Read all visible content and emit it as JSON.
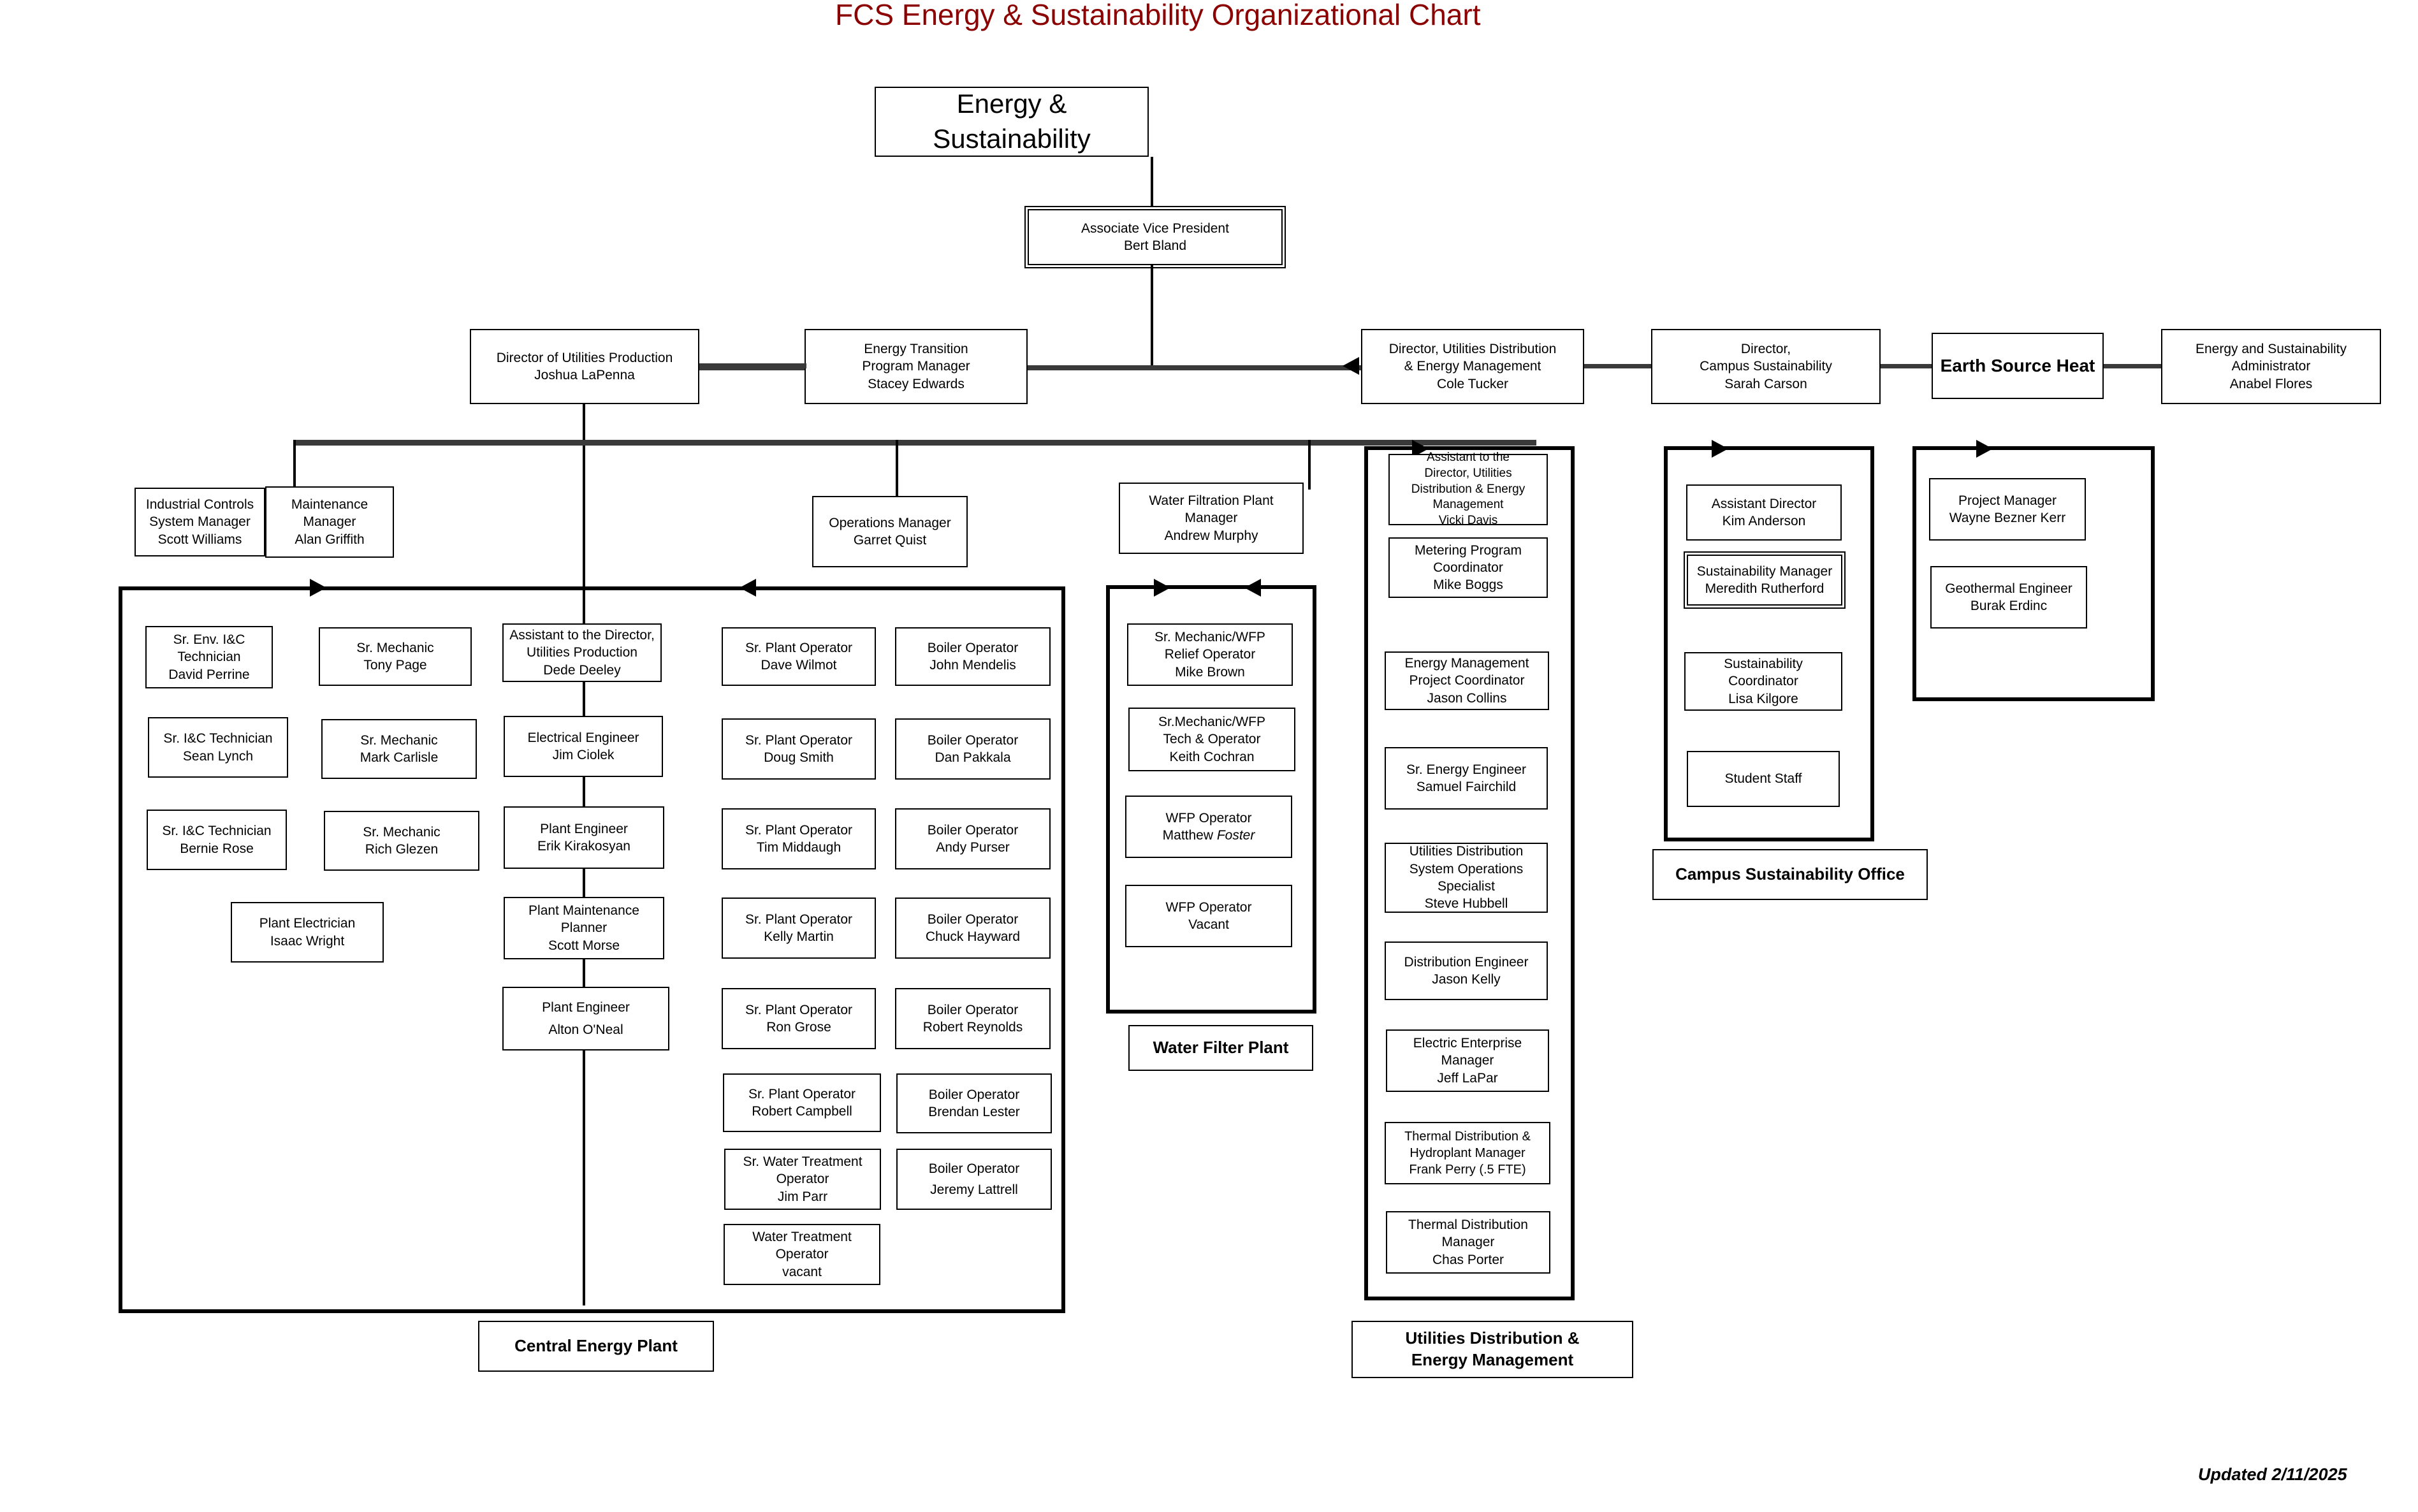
{
  "title": "FCS Energy & Sustainability Organizational Chart",
  "footer": "Updated 2/11/2025",
  "root": {
    "label": "Energy & Sustainability"
  },
  "avp": {
    "title": "Associate Vice President",
    "name": "Bert Bland"
  },
  "directors": {
    "utilities_production": {
      "title": "Director of Utilities Production",
      "name": "Joshua LaPenna"
    },
    "energy_transition": {
      "line1": "Energy  Transition",
      "line2": "Program Manager",
      "name": "Stacey Edwards"
    },
    "utilities_distribution": {
      "line1": "Director, Utilities Distribution",
      "line2": "& Energy Management",
      "name": "Cole Tucker"
    },
    "campus_sustainability": {
      "line1": "Director,",
      "line2": "Campus Sustainability",
      "name": "Sarah Carson"
    },
    "earth_source_heat": {
      "label": "Earth Source Heat"
    },
    "admin": {
      "line1": "Energy and Sustainability",
      "line2": "Administrator",
      "name": "Anabel Flores"
    }
  },
  "managers": {
    "industrial_controls": {
      "line1": "Industrial Controls",
      "line2": "System Manager",
      "name": "Scott Williams"
    },
    "maintenance": {
      "line1": "Maintenance",
      "line2": "Manager",
      "name": "Alan Griffith"
    },
    "operations": {
      "line1": "Operations Manager",
      "name": "Garret Quist"
    },
    "water_filtration": {
      "line1": "Water Filtration Plant",
      "line2": "Manager",
      "name": "Andrew Murphy"
    }
  },
  "group_labels": {
    "central_energy_plant": "Central Energy Plant",
    "water_filter_plant": "Water Filter Plant",
    "utilities_distribution_energy_management": {
      "line1": "Utilities Distribution &",
      "line2": "Energy Management"
    },
    "campus_sustainability_office": "Campus Sustainability Office"
  },
  "columns": {
    "ic_technicians": [
      {
        "line1": "Sr. Env. I&C",
        "line2": "Technician",
        "name": "David Perrine"
      },
      {
        "line1": "Sr. I&C Technician",
        "name": "Sean Lynch"
      },
      {
        "line1": "Sr. I&C Technician",
        "name": "Bernie Rose"
      }
    ],
    "plant_electrician": {
      "line1": "Plant Electrician",
      "name": "Isaac Wright"
    },
    "mechanics": [
      {
        "line1": "Sr. Mechanic",
        "name": "Tony Page"
      },
      {
        "line1": "Sr. Mechanic",
        "name": "Mark Carlisle"
      },
      {
        "line1": "Sr. Mechanic",
        "name": "Rich Glezen"
      }
    ],
    "engineering": [
      {
        "line1": "Assistant to the Director,",
        "line2": "Utilities Production",
        "name": "Dede Deeley"
      },
      {
        "line1": "Electrical Engineer",
        "name": "Jim Ciolek"
      },
      {
        "line1": "Plant Engineer",
        "name": "Erik Kirakosyan"
      },
      {
        "line1": "Plant Maintenance",
        "line2": "Planner",
        "name": "Scott Morse"
      },
      {
        "line1": "Plant Engineer",
        "name": "Alton O'Neal"
      }
    ],
    "plant_operators": [
      {
        "line1": "Sr. Plant Operator",
        "name": "Dave Wilmot"
      },
      {
        "line1": "Sr. Plant Operator",
        "name": "Doug Smith"
      },
      {
        "line1": "Sr. Plant Operator",
        "name": "Tim Middaugh"
      },
      {
        "line1": "Sr. Plant Operator",
        "name": "Kelly Martin"
      },
      {
        "line1": "Sr. Plant Operator",
        "name": "Ron Grose"
      },
      {
        "line1": "Sr. Plant Operator",
        "name": "Robert Campbell"
      },
      {
        "line1": "Sr. Water Treatment",
        "line2": "Operator",
        "name": "Jim Parr"
      },
      {
        "line1": "Water Treatment",
        "line2": "Operator",
        "name": "vacant"
      }
    ],
    "boiler_operators": [
      {
        "line1": "Boiler Operator",
        "name": "John Mendelis"
      },
      {
        "line1": "Boiler Operator",
        "name": "Dan Pakkala"
      },
      {
        "line1": "Boiler Operator",
        "name": "Andy Purser"
      },
      {
        "line1": "Boiler Operator",
        "name": "Chuck Hayward"
      },
      {
        "line1": "Boiler Operator",
        "name": "Robert Reynolds"
      },
      {
        "line1": "Boiler Operator",
        "name": "Brendan Lester"
      },
      {
        "line1": "Boiler Operator",
        "name": "Jeremy Lattrell"
      }
    ],
    "water_filter_plant": [
      {
        "line1": "Sr. Mechanic/WFP",
        "line2": "Relief Operator",
        "name": "Mike Brown"
      },
      {
        "line1": "Sr.Mechanic/WFP",
        "line2": "Tech & Operator",
        "name": "Keith Cochran"
      },
      {
        "line1": "WFP Operator",
        "name": "Matthew ",
        "name_italic": "Foster"
      },
      {
        "line1": "WFP Operator",
        "name": "Vacant"
      }
    ],
    "utilities_distribution": [
      {
        "line1": "Assistant to the",
        "line2": "Director, Utilities",
        "line3": "Distribution & Energy",
        "line4": "Management",
        "name": "Vicki Davis"
      },
      {
        "line1": "Metering Program",
        "line2": "Coordinator",
        "name": "Mike Boggs"
      },
      {
        "line1": "Energy Management",
        "line2": "Project Coordinator",
        "name": "Jason Collins"
      },
      {
        "line1": "Sr. Energy Engineer",
        "name": "Samuel Fairchild"
      },
      {
        "line1": "Utilities Distribution",
        "line2": "System Operations",
        "line3": "Specialist",
        "name": "Steve Hubbell"
      },
      {
        "line1": "Distribution Engineer",
        "name": "Jason Kelly"
      },
      {
        "line1": "Electric Enterprise",
        "line2": "Manager",
        "name": "Jeff LaPar"
      },
      {
        "line1": "Thermal Distribution &",
        "line2": "Hydroplant  Manager",
        "name": "Frank Perry (.5 FTE)"
      },
      {
        "line1": "Thermal Distribution",
        "line2": "Manager",
        "name": "Chas Porter"
      }
    ],
    "campus_sustainability": [
      {
        "line1": "Assistant Director",
        "name": "Kim Anderson"
      },
      {
        "line1": "Sustainability Manager",
        "name": "Meredith Rutherford"
      },
      {
        "line1": "Sustainability",
        "line2": "Coordinator",
        "name": "Lisa Kilgore"
      },
      {
        "line1": "Student Staff"
      }
    ],
    "earth_source_heat": [
      {
        "line1": "Project Manager",
        "name": "Wayne Bezner Kerr"
      },
      {
        "line1": "Geothermal Engineer",
        "name": "Burak Erdinc"
      }
    ]
  },
  "colors": {
    "title": "#8B0000",
    "line": "#000000",
    "box_border": "#000000",
    "background": "#ffffff"
  }
}
